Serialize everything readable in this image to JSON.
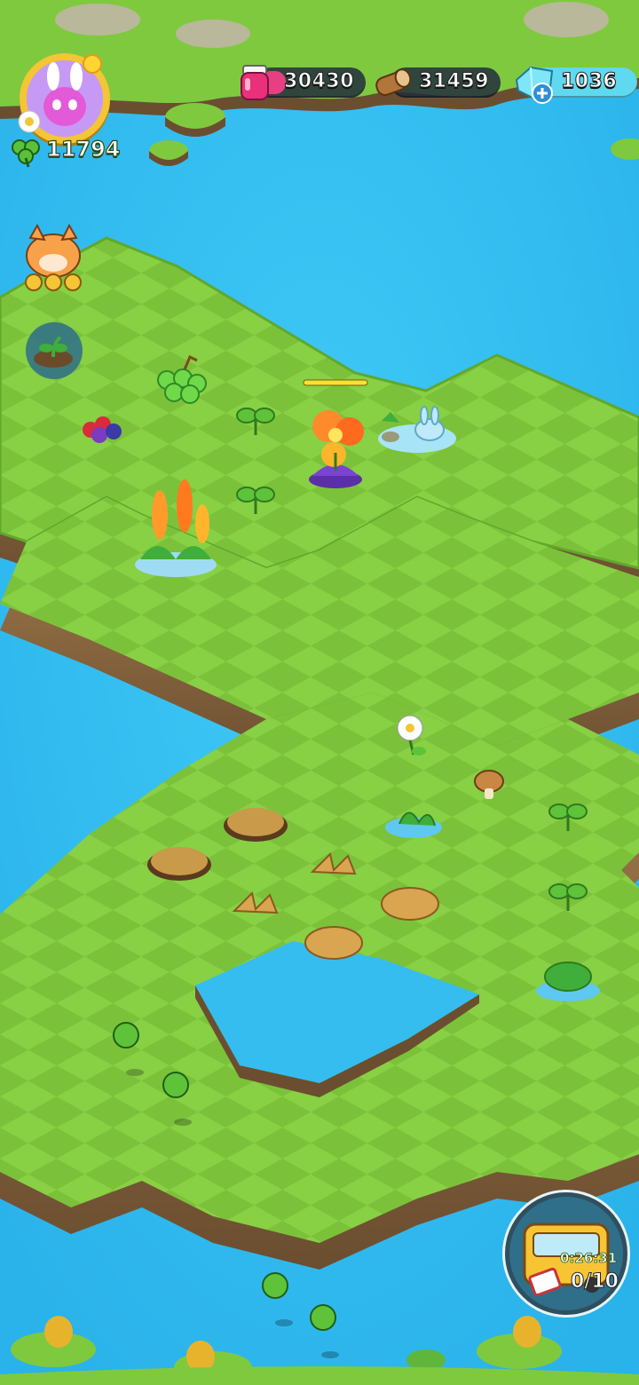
{
  "hud": {
    "player_level_currency": "11794",
    "resources": [
      {
        "name": "jam",
        "icon": "jam-jar-icon",
        "value": "30430",
        "fill_fraction": 0.2,
        "fill_color": "#e83f82"
      },
      {
        "name": "wood",
        "icon": "wood-log-icon",
        "value": "31459"
      },
      {
        "name": "gems",
        "icon": "blue-gem-icon",
        "value": "1036"
      }
    ],
    "add_gems_icon": "plus-icon"
  },
  "side_buttons": {
    "fox_character": "fox-clover-icon",
    "sprout_shop": "sprout-icon"
  },
  "bus_event": {
    "timer": "0:26:31",
    "progress_text": "0/10",
    "icon": "bus-icon"
  },
  "colors": {
    "water": "#35bdf0",
    "grass_light": "#8fd648",
    "grass_dark": "#7cc63c",
    "cliff": "#8a6a45",
    "accent_gold": "#f4c535"
  }
}
